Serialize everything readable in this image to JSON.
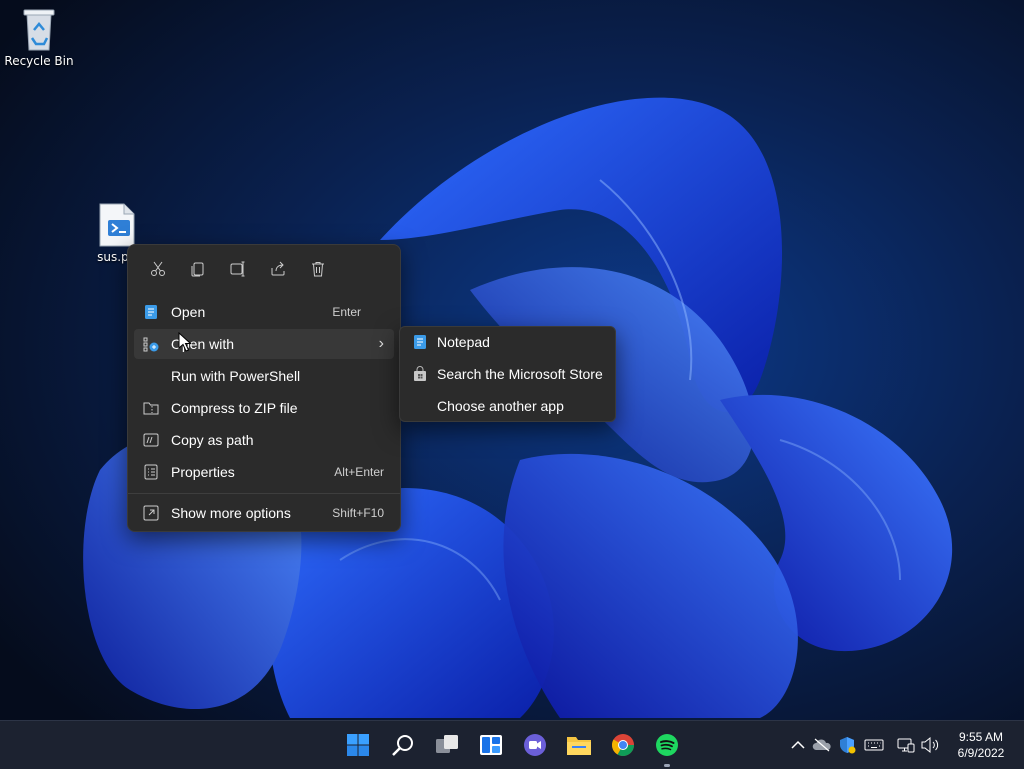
{
  "desktop": {
    "icons": [
      {
        "label": "Recycle Bin",
        "icon": "recycle-bin-icon"
      },
      {
        "label": "sus.ps",
        "icon": "powershell-script-icon"
      }
    ]
  },
  "context_menu": {
    "toolbar": [
      {
        "name": "Cut",
        "icon": "cut-icon"
      },
      {
        "name": "Copy",
        "icon": "copy-icon"
      },
      {
        "name": "Rename",
        "icon": "rename-icon"
      },
      {
        "name": "Share",
        "icon": "share-icon"
      },
      {
        "name": "Delete",
        "icon": "delete-icon"
      }
    ],
    "items": [
      {
        "label": "Open",
        "shortcut": "Enter",
        "icon": "notepad-icon"
      },
      {
        "label": "Open with",
        "shortcut": "",
        "icon": "open-with-icon",
        "submenu_arrow": "›"
      },
      {
        "label": "Run with PowerShell",
        "shortcut": "",
        "icon": ""
      },
      {
        "label": "Compress to ZIP file",
        "shortcut": "",
        "icon": "zip-folder-icon"
      },
      {
        "label": "Copy as path",
        "shortcut": "",
        "icon": "copy-path-icon"
      },
      {
        "label": "Properties",
        "shortcut": "Alt+Enter",
        "icon": "properties-icon"
      },
      {
        "label": "Show more options",
        "shortcut": "Shift+F10",
        "icon": "more-options-icon"
      }
    ]
  },
  "submenu": {
    "items": [
      {
        "label": "Notepad",
        "icon": "notepad-icon"
      },
      {
        "label": "Search the Microsoft Store",
        "icon": "store-icon"
      },
      {
        "label": "Choose another app",
        "icon": ""
      }
    ]
  },
  "taskbar": {
    "apps": [
      "start-icon",
      "search-icon",
      "task-view-icon",
      "widgets-icon",
      "teams-chat-icon",
      "file-explorer-icon",
      "chrome-icon",
      "spotify-icon"
    ],
    "tray": [
      "chevron-up-icon",
      "onedrive-icon",
      "security-icon",
      "keyboard-icon",
      "network-icon",
      "volume-icon"
    ],
    "clock": {
      "time": "9:55 AM",
      "date": "6/9/2022"
    }
  },
  "colors": {
    "menu_bg": "#2b2b2b",
    "accent": "#3b82f6",
    "taskbar_bg": "#1c2230"
  }
}
